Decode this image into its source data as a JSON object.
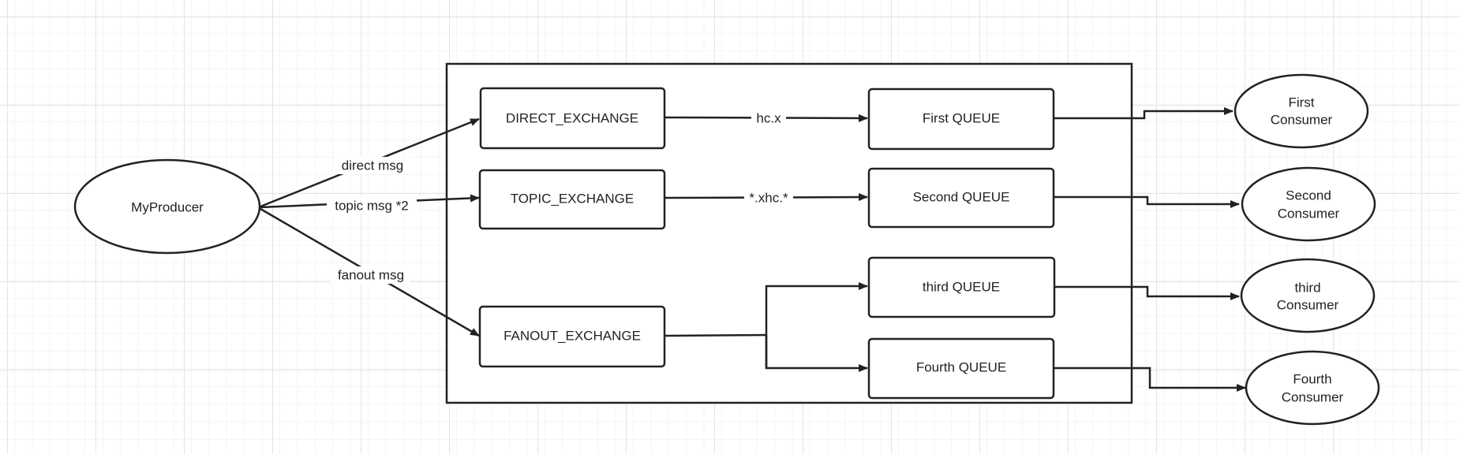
{
  "producer": {
    "label": "MyProducer"
  },
  "exchanges": [
    {
      "label": "DIRECT_EXCHANGE",
      "edge_label": "direct msg"
    },
    {
      "label": "TOPIC_EXCHANGE",
      "edge_label": "topic msg *2"
    },
    {
      "label": "FANOUT_EXCHANGE",
      "edge_label": "fanout msg"
    }
  ],
  "bindings": [
    {
      "label": "hc.x"
    },
    {
      "label": "*.xhc.*"
    }
  ],
  "queues": [
    {
      "label": "First QUEUE"
    },
    {
      "label": "Second QUEUE"
    },
    {
      "label": "third QUEUE"
    },
    {
      "label": "Fourth QUEUE"
    }
  ],
  "consumers": [
    {
      "line1": "First",
      "line2": "Consumer"
    },
    {
      "line1": "Second",
      "line2": "Consumer"
    },
    {
      "line1": "third",
      "line2": "Consumer"
    },
    {
      "line1": "Fourth",
      "line2": "Consumer"
    }
  ],
  "colors": {
    "stroke": "#222222",
    "grid_minor": "#f2f2f2",
    "grid_major": "#e4e4e4",
    "background": "#ffffff"
  }
}
